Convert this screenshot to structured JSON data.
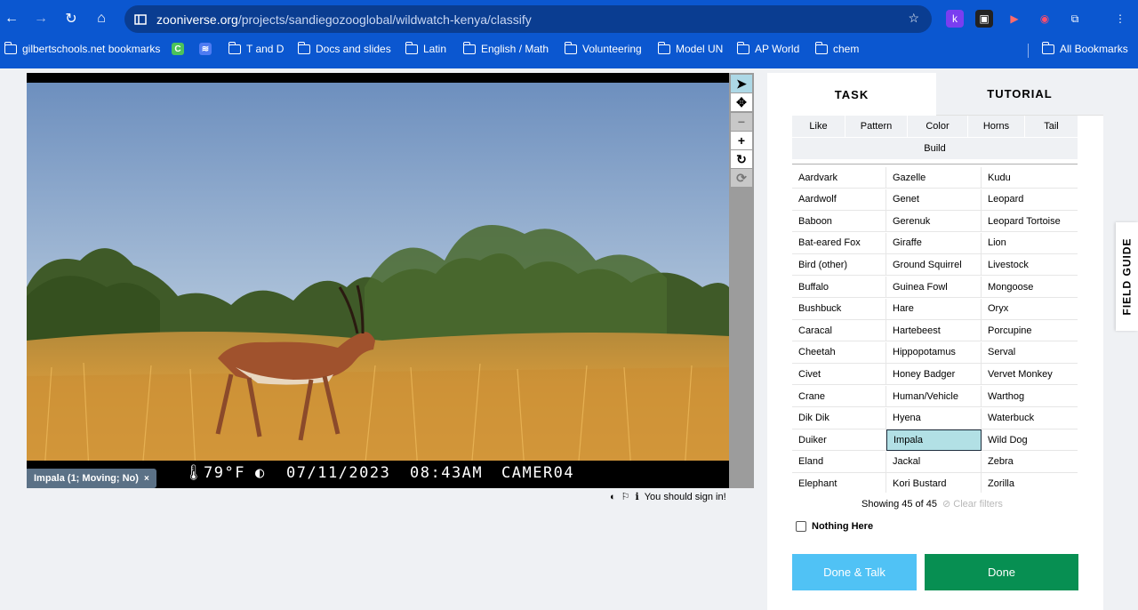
{
  "browser": {
    "url_host": "zooniverse.org",
    "url_path": "/projects/sandiegozooglobal/wildwatch-kenya/classify",
    "bookmarks": [
      {
        "label": "gilbertschools.net bookmarks",
        "kind": "managed"
      },
      {
        "label": "",
        "kind": "app-c"
      },
      {
        "label": "",
        "kind": "app-stripes"
      },
      {
        "label": "T and D",
        "kind": "folder"
      },
      {
        "label": "Docs and slides",
        "kind": "folder"
      },
      {
        "label": "Latin",
        "kind": "folder"
      },
      {
        "label": "English / Math",
        "kind": "folder"
      },
      {
        "label": "Volunteering",
        "kind": "folder"
      },
      {
        "label": "Model UN",
        "kind": "folder"
      },
      {
        "label": "AP World",
        "kind": "folder"
      },
      {
        "label": "chem",
        "kind": "folder"
      }
    ],
    "all_bookmarks": "All Bookmarks"
  },
  "viewer": {
    "stamp_temp": "79°F",
    "stamp_date": "07/11/2023",
    "stamp_time": "08:43AM",
    "stamp_camera": "CAMER04",
    "annotation_tag": "Impala (1; Moving; No)",
    "annotation_close": "×",
    "sign_in_notice": "You should sign in!"
  },
  "panel": {
    "tab_task": "TASK",
    "tab_tutorial": "TUTORIAL",
    "filters": [
      "Like",
      "Pattern",
      "Color",
      "Horns",
      "Tail",
      "Build"
    ],
    "species_col1": [
      "Aardvark",
      "Aardwolf",
      "Baboon",
      "Bat-eared Fox",
      "Bird (other)",
      "Buffalo",
      "Bushbuck",
      "Caracal",
      "Cheetah",
      "Civet",
      "Crane",
      "Dik Dik",
      "Duiker",
      "Eland",
      "Elephant"
    ],
    "species_col2": [
      "Gazelle",
      "Genet",
      "Gerenuk",
      "Giraffe",
      "Ground Squirrel",
      "Guinea Fowl",
      "Hare",
      "Hartebeest",
      "Hippopotamus",
      "Honey Badger",
      "Human/Vehicle",
      "Hyena",
      "Impala",
      "Jackal",
      "Kori Bustard"
    ],
    "species_col3": [
      "Kudu",
      "Leopard",
      "Leopard Tortoise",
      "Lion",
      "Livestock",
      "Mongoose",
      "Oryx",
      "Porcupine",
      "Serval",
      "Vervet Monkey",
      "Warthog",
      "Waterbuck",
      "Wild Dog",
      "Zebra",
      "Zorilla"
    ],
    "selected_species": "Impala",
    "showing": "Showing 45 of 45",
    "clear_filters": "Clear filters",
    "nothing_here": "Nothing Here",
    "done_talk": "Done & Talk",
    "done": "Done",
    "field_guide": "FIELD GUIDE"
  },
  "colors": {
    "chrome": "#0b57d0",
    "done": "#078f52",
    "done_talk": "#50c2f5",
    "selected": "#b2e0e5"
  }
}
